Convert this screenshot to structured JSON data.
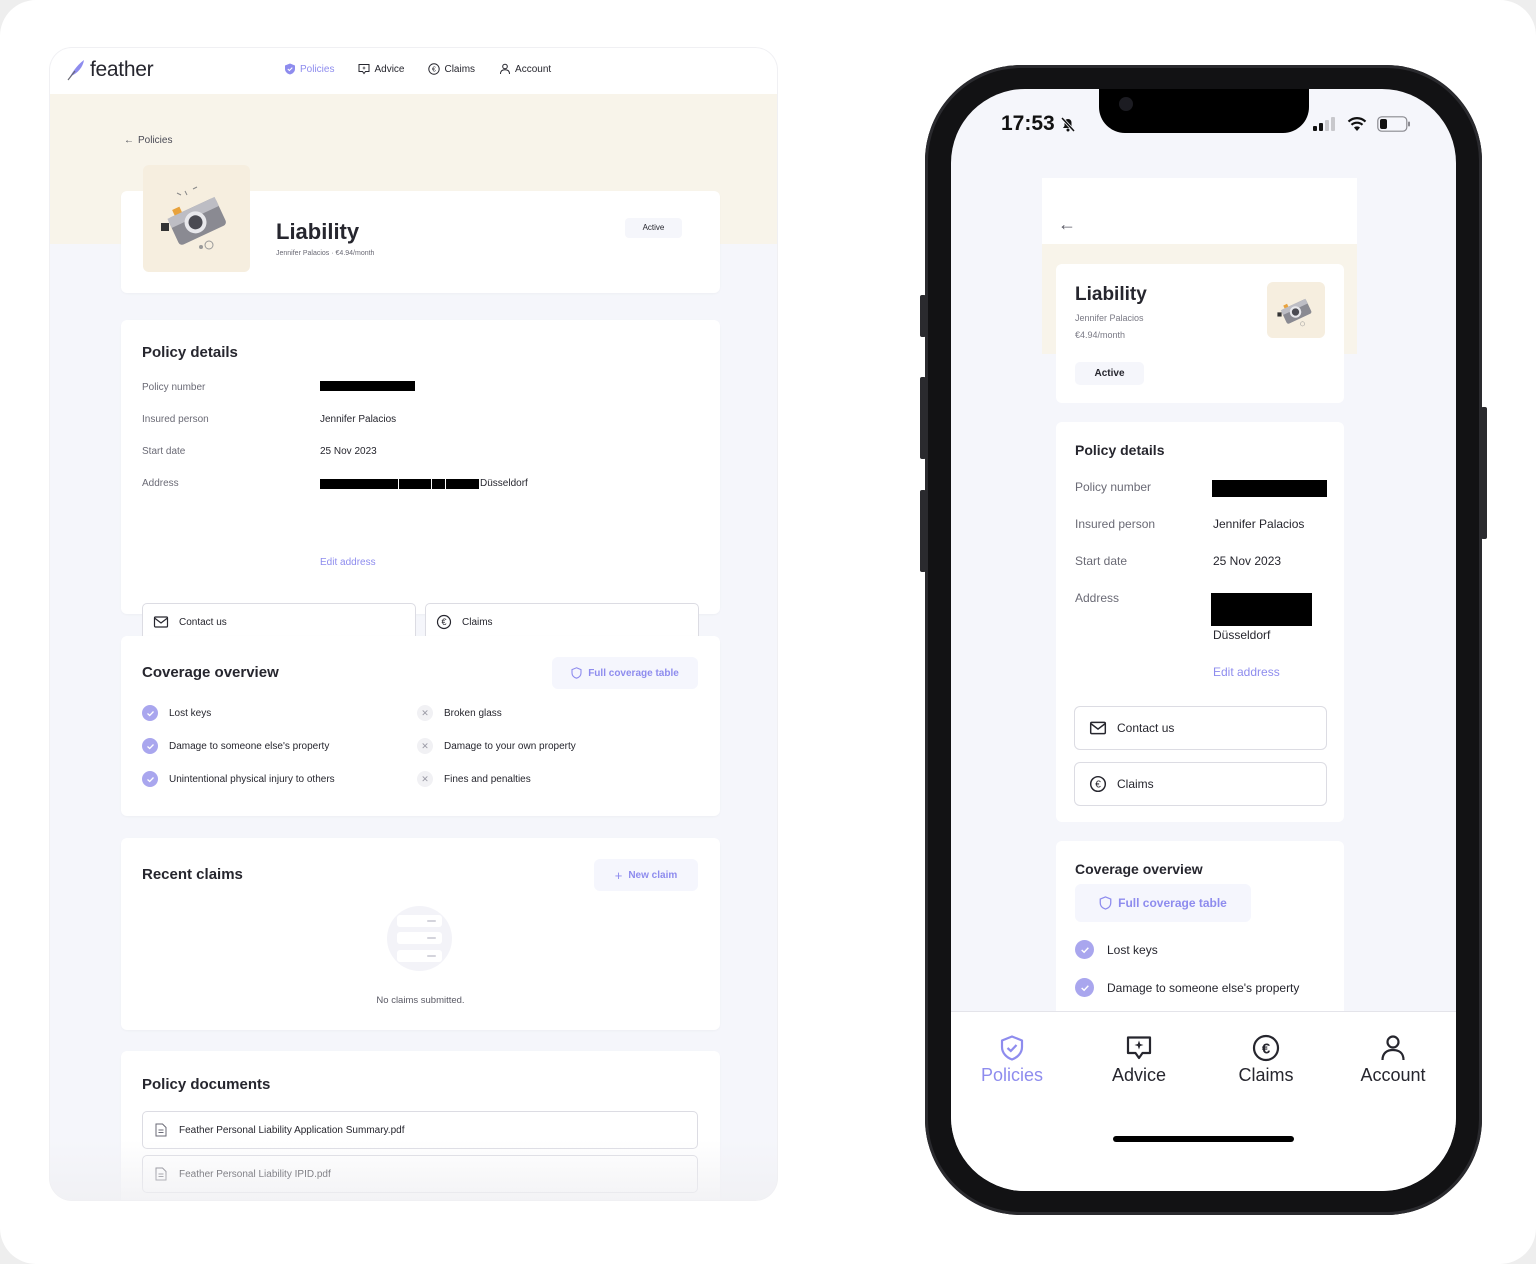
{
  "colors": {
    "accent": "#8e8cee",
    "hero_band": "#f8f4ea",
    "page_bg": "#f5f6fb"
  },
  "desktop": {
    "brand": "feather",
    "nav": [
      {
        "label": "Policies",
        "icon": "shield-check-icon",
        "active": true
      },
      {
        "label": "Advice",
        "icon": "chat-sparkle-icon",
        "active": false
      },
      {
        "label": "Claims",
        "icon": "euro-circle-icon",
        "active": false
      },
      {
        "label": "Account",
        "icon": "user-icon",
        "active": false
      }
    ],
    "back_label": "Policies",
    "policy": {
      "title": "Liability",
      "subtitle": "Jennifer Palacios · €4.94/month",
      "status": "Active"
    },
    "policy_details": {
      "title": "Policy details",
      "rows": [
        {
          "label": "Policy number",
          "value": "[redacted]"
        },
        {
          "label": "Insured person",
          "value": "Jennifer Palacios"
        },
        {
          "label": "Start date",
          "value": "25 Nov 2023"
        },
        {
          "label": "Address",
          "value": "Düsseldorf"
        }
      ],
      "edit_address": "Edit address",
      "contact_button": "Contact us",
      "claims_button": "Claims"
    },
    "coverage": {
      "title": "Coverage overview",
      "table_button": "Full coverage table",
      "covered": [
        "Lost keys",
        "Damage to someone else's property",
        "Unintentional physical injury to others"
      ],
      "not_covered": [
        "Broken glass",
        "Damage to your own property",
        "Fines and penalties"
      ]
    },
    "recent_claims": {
      "title": "Recent claims",
      "new_claim_button": "New claim",
      "empty_text": "No claims submitted."
    },
    "documents": {
      "title": "Policy documents",
      "files": [
        "Feather Personal Liability Application Summary.pdf",
        "Feather Personal Liability IPID.pdf"
      ]
    }
  },
  "phone": {
    "status_time": "17:53",
    "battery_level": 0.2,
    "policy": {
      "title": "Liability",
      "holder": "Jennifer Palacios",
      "price": "€4.94/month",
      "status": "Active"
    },
    "policy_details": {
      "title": "Policy details",
      "rows": [
        {
          "label": "Policy number",
          "value": "[redacted]"
        },
        {
          "label": "Insured person",
          "value": "Jennifer Palacios"
        },
        {
          "label": "Start date",
          "value": "25 Nov 2023"
        },
        {
          "label": "Address",
          "value": "Düsseldorf"
        }
      ],
      "edit_address": "Edit address",
      "contact_button": "Contact us",
      "claims_button": "Claims"
    },
    "coverage": {
      "title": "Coverage overview",
      "table_button": "Full coverage table",
      "covered": [
        "Lost keys",
        "Damage to someone else's property"
      ]
    },
    "tabs": [
      {
        "label": "Policies",
        "active": true
      },
      {
        "label": "Advice",
        "active": false
      },
      {
        "label": "Claims",
        "active": false
      },
      {
        "label": "Account",
        "active": false
      }
    ]
  }
}
